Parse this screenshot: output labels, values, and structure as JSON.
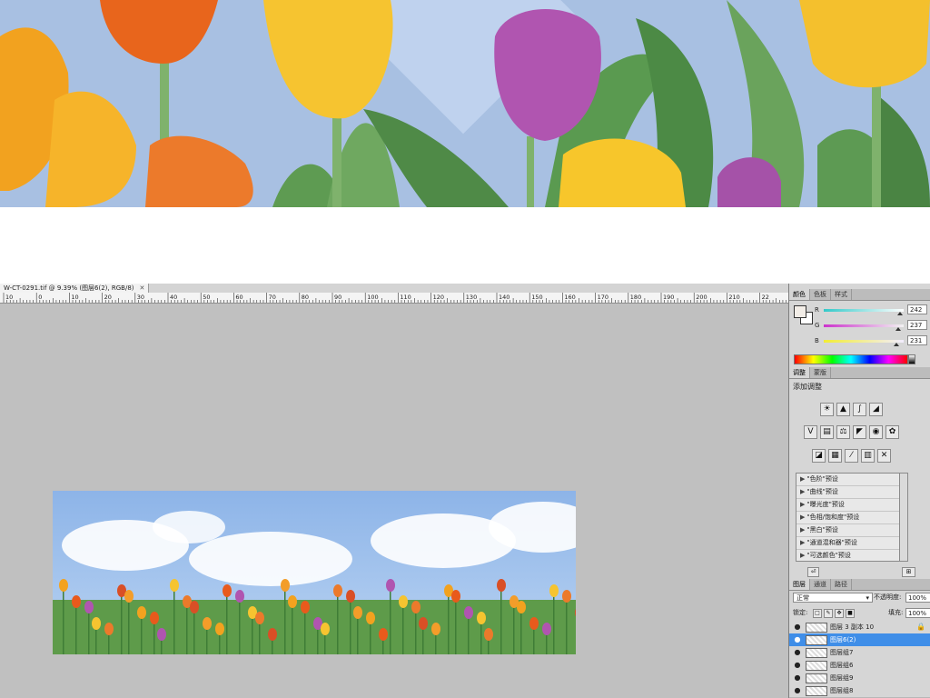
{
  "document": {
    "tab_title": "W-CT-0291.tif @ 9.39% (图层6(2), RGB/8)",
    "close_glyph": "✕"
  },
  "ruler": {
    "labels": [
      "10",
      "0",
      "10",
      "20",
      "30",
      "40",
      "50",
      "60",
      "70",
      "80",
      "90",
      "100",
      "110",
      "120",
      "130",
      "140",
      "150",
      "160",
      "170",
      "180",
      "190",
      "200",
      "210",
      "22"
    ]
  },
  "color_panel": {
    "tabs": [
      "颜色",
      "色板",
      "样式"
    ],
    "active_tab": 0,
    "foreground": "#f2ede7",
    "background": "#ffffff",
    "channels": [
      {
        "label": "R",
        "value": "242",
        "level": 0.949,
        "color_from": "#33c9c9",
        "color_to": "#ffffff"
      },
      {
        "label": "G",
        "value": "237",
        "level": 0.929,
        "color_from": "#cc33cc",
        "color_to": "#f2f2f2"
      },
      {
        "label": "B",
        "value": "231",
        "level": 0.906,
        "color_from": "#f2ed33",
        "color_to": "#f2edff"
      }
    ]
  },
  "adjust_panel": {
    "tabs": [
      "调整",
      "蒙版"
    ],
    "active_tab": 0,
    "heading": "添加调整",
    "icon_rows": [
      [
        "brightness-contrast-icon",
        "levels-icon",
        "curves-icon",
        "exposure-icon"
      ],
      [
        "vibrance-icon",
        "hue-saturation-icon",
        "color-balance-icon",
        "black-white-icon",
        "photo-filter-icon",
        "channel-mixer-icon"
      ],
      [
        "invert-icon",
        "posterize-icon",
        "threshold-icon",
        "gradient-map-icon",
        "selective-color-icon"
      ]
    ],
    "icon_glyphs": [
      [
        "☀",
        "▲",
        "∫",
        "◢"
      ],
      [
        "V",
        "▤",
        "⚖",
        "◤",
        "◉",
        "✿"
      ],
      [
        "◪",
        "▦",
        "⁄",
        "▥",
        "✕"
      ]
    ],
    "presets": [
      "\"色阶\"预设",
      "\"曲线\"预设",
      "\"曝光度\"预设",
      "\"色相/饱和度\"预设",
      "\"黑白\"预设",
      "\"通道混和器\"预设",
      "\"可选颜色\"预设"
    ],
    "arrow_glyph": "▶"
  },
  "layers_panel": {
    "tabs": [
      "图层",
      "通道",
      "路径"
    ],
    "active_tab": 0,
    "blend_mode": "正常",
    "opacity_label": "不透明度:",
    "opacity_value": "100%",
    "lock_label": "锁定:",
    "fill_label": "填充:",
    "fill_value": "100%",
    "eye_glyph": "●",
    "lock_glyph": "🔒",
    "layers": [
      {
        "name": "图层 3 副本 10",
        "selected": false,
        "locked": true
      },
      {
        "name": "图层6(2)",
        "selected": true,
        "locked": false
      },
      {
        "name": "图层组7",
        "selected": false,
        "locked": false
      },
      {
        "name": "图层组6",
        "selected": false,
        "locked": false
      },
      {
        "name": "图层组9",
        "selected": false,
        "locked": false
      },
      {
        "name": "图层组8",
        "selected": false,
        "locked": false
      }
    ]
  }
}
